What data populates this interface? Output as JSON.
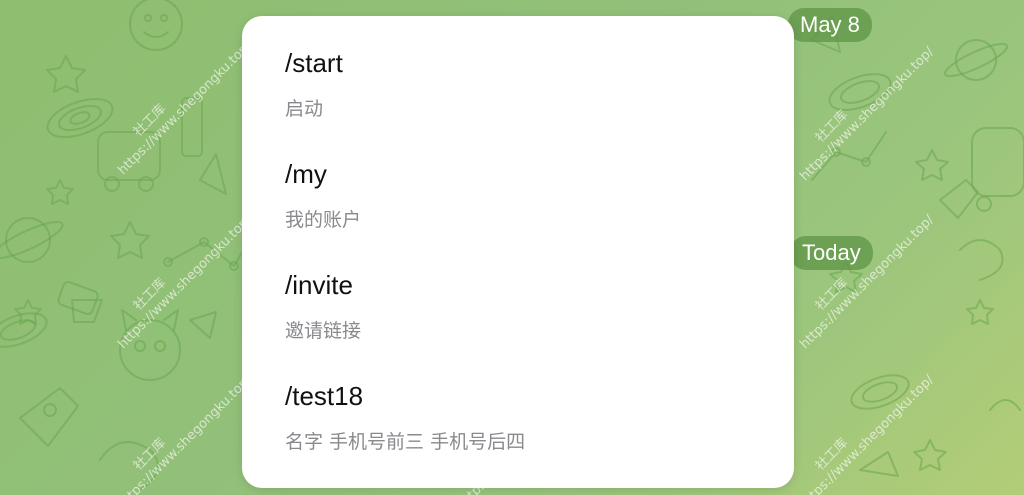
{
  "dates": {
    "may8": "May 8",
    "today": "Today"
  },
  "commands": [
    {
      "name": "/start",
      "description": "启动"
    },
    {
      "name": "/my",
      "description": "我的账户"
    },
    {
      "name": "/invite",
      "description": "邀请链接"
    },
    {
      "name": "/test18",
      "description": "名字 手机号前三 手机号后四"
    }
  ],
  "watermark": {
    "url": "https://www.shegongku.top/",
    "brand": "社工库"
  },
  "colors": {
    "chat_background": "#92c07a",
    "date_pill": "#6a9a4a",
    "menu_background": "#ffffff",
    "command_text": "#111111",
    "description_text": "#8a8a8e"
  }
}
